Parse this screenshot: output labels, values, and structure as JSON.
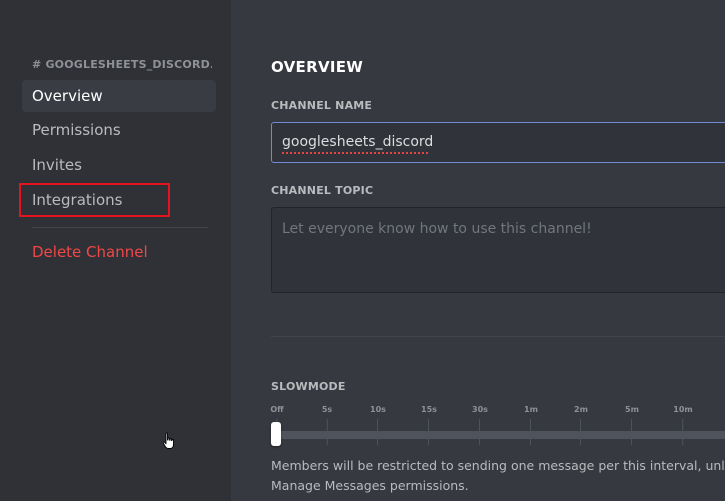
{
  "sidebar": {
    "header": "# GOOGLESHEETS_DISCORD...",
    "items": [
      {
        "label": "Overview"
      },
      {
        "label": "Permissions"
      },
      {
        "label": "Invites"
      },
      {
        "label": "Integrations"
      }
    ],
    "delete_label": "Delete Channel"
  },
  "main": {
    "title": "OVERVIEW",
    "channel_name": {
      "label": "CHANNEL NAME",
      "value": "googlesheets_discord"
    },
    "channel_topic": {
      "label": "CHANNEL TOPIC",
      "placeholder": "Let everyone know how to use this channel!"
    },
    "slowmode": {
      "label": "SLOWMODE",
      "ticks": [
        "Off",
        "5s",
        "10s",
        "15s",
        "30s",
        "1m",
        "2m",
        "5m",
        "10m"
      ],
      "selected": "Off",
      "help_line1": "Members will be restricted to sending one message per this interval, unless th",
      "help_line2": "Manage Messages permissions."
    }
  },
  "colors": {
    "accent": "#7289da",
    "danger": "#f04747",
    "highlight": "#e3141c"
  },
  "icons": {
    "cursor": "hand-pointer-icon"
  }
}
